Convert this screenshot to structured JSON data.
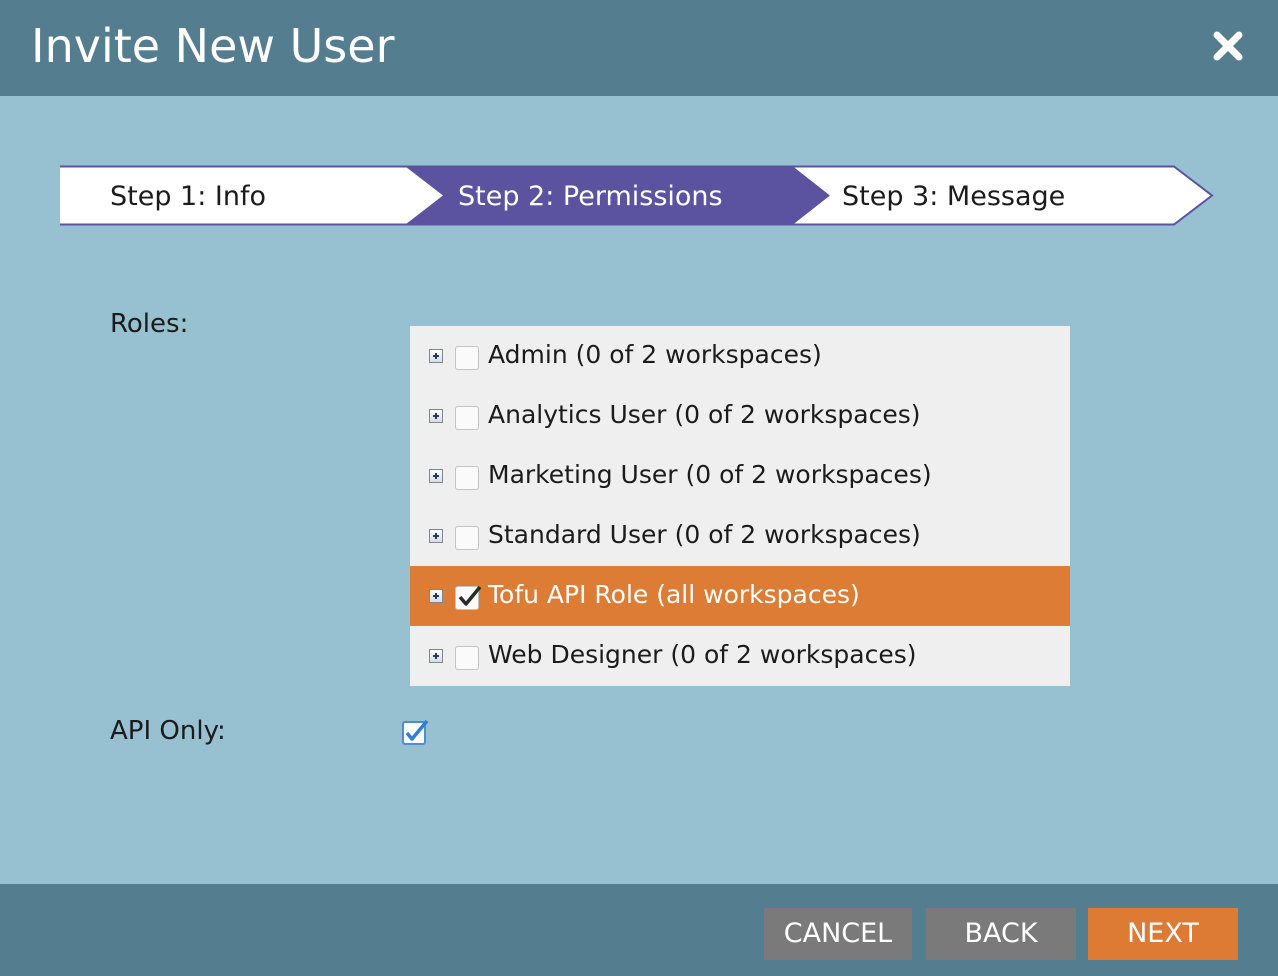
{
  "dialog": {
    "title": "Invite New User",
    "close_icon": "close-icon"
  },
  "steps": [
    {
      "label": "Step 1: Info",
      "state": "completed"
    },
    {
      "label": "Step 2: Permissions",
      "state": "active"
    },
    {
      "label": "Step 3: Message",
      "state": "pending"
    }
  ],
  "form": {
    "roles_label": "Roles:",
    "roles": [
      {
        "label": "Admin (0 of 2 workspaces)",
        "checked": false,
        "selected": false
      },
      {
        "label": "Analytics User (0 of 2 workspaces)",
        "checked": false,
        "selected": false
      },
      {
        "label": "Marketing User (0 of 2 workspaces)",
        "checked": false,
        "selected": false
      },
      {
        "label": "Standard User (0 of 2 workspaces)",
        "checked": false,
        "selected": false
      },
      {
        "label": "Tofu API Role (all workspaces)",
        "checked": true,
        "selected": true
      },
      {
        "label": "Web Designer (0 of 2 workspaces)",
        "checked": false,
        "selected": false
      }
    ],
    "api_only_label": "API Only:",
    "api_only_checked": true
  },
  "footer": {
    "cancel_label": "CANCEL",
    "back_label": "BACK",
    "next_label": "NEXT"
  },
  "colors": {
    "header": "#547d90",
    "body": "#97c0d1",
    "active_step": "#5b52a0",
    "selected_row": "#dc7c35",
    "primary_button": "#dd7a34",
    "secondary_button": "#7a7a7a"
  }
}
